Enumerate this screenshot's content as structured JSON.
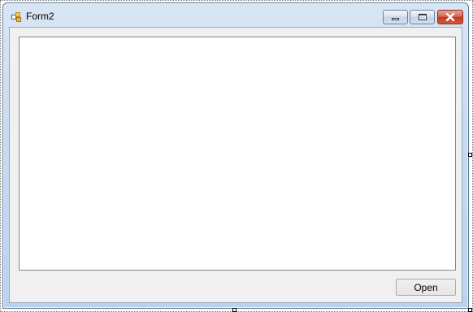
{
  "window": {
    "title": "Form2",
    "icon": "winforms-app-icon",
    "controls": {
      "minimize": "minimize-icon",
      "maximize": "maximize-icon",
      "close": "close-icon"
    }
  },
  "form": {
    "open_button_label": "Open"
  },
  "colors": {
    "frame": "#bcd3ec",
    "client_background": "#f0f0f0",
    "panel_background": "#ffffff",
    "close_button": "#c03a22"
  }
}
